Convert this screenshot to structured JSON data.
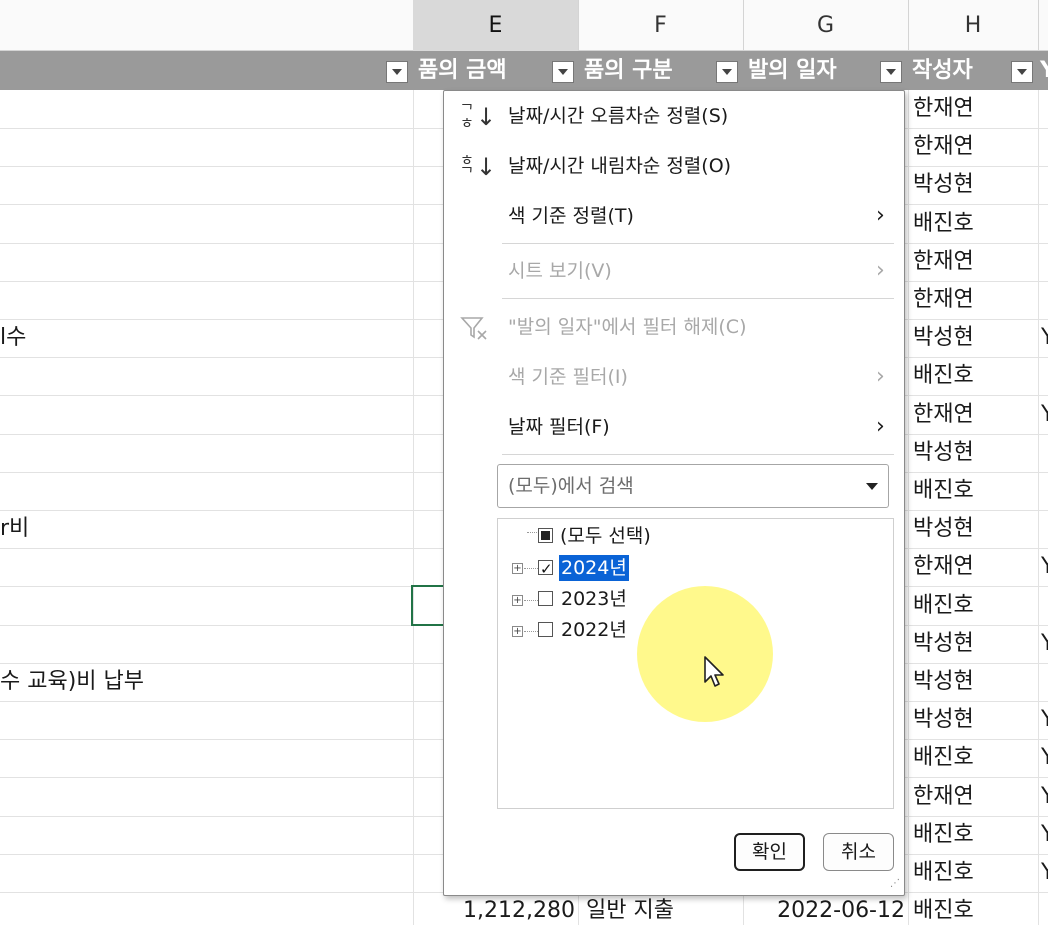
{
  "columns": {
    "E": {
      "label": "E",
      "selected": true
    },
    "F": {
      "label": "F"
    },
    "G": {
      "label": "G"
    },
    "H": {
      "label": "H"
    }
  },
  "table_header": {
    "col_e": "품의 금액",
    "col_f": "품의 구분",
    "col_g": "발의 일자",
    "col_h": "작성자",
    "col_i": "Y"
  },
  "rows": [
    {
      "d": "",
      "h": "한재연",
      "i": ""
    },
    {
      "d": "",
      "h": "한재연",
      "i": ""
    },
    {
      "d": "",
      "h": "박성현",
      "i": ""
    },
    {
      "d": "",
      "h": "배진호",
      "i": ""
    },
    {
      "d": "",
      "h": "한재연",
      "i": ""
    },
    {
      "d": "",
      "h": "한재연",
      "i": ""
    },
    {
      "d": "l수",
      "h": "박성현",
      "i": "Y"
    },
    {
      "d": "",
      "h": "배진호",
      "i": ""
    },
    {
      "d": "",
      "h": "한재연",
      "i": "Y"
    },
    {
      "d": "",
      "h": "박성현",
      "i": ""
    },
    {
      "d": "",
      "h": "배진호",
      "i": ""
    },
    {
      "d": "r비",
      "h": "박성현",
      "i": ""
    },
    {
      "d": "",
      "h": "한재연",
      "i": "Y"
    },
    {
      "d": "",
      "h": "배진호",
      "i": ""
    },
    {
      "d": "",
      "h": "박성현",
      "i": "Y"
    },
    {
      "d": "수 교육)비 납부",
      "h": "박성현",
      "i": ""
    },
    {
      "d": "",
      "h": "박성현",
      "i": "Y"
    },
    {
      "d": "",
      "h": "배진호",
      "i": "Y"
    },
    {
      "d": "",
      "h": "한재연",
      "i": "Y"
    },
    {
      "d": "",
      "h": "배진호",
      "i": "Y"
    },
    {
      "d": "",
      "h": "배진호",
      "i": "Y"
    }
  ],
  "last_row": {
    "amount": "1,212,280",
    "type": "일반 지출",
    "date": "2022-06-12",
    "author": "배진호"
  },
  "menu": {
    "sort_asc": "날짜/시간 오름차순 정렬(S)",
    "sort_desc": "날짜/시간 내림차순 정렬(O)",
    "sort_color": "색 기준 정렬(T)",
    "sheet_view": "시트 보기(V)",
    "clear_filter": "\"발의 일자\"에서 필터 해제(C)",
    "filter_color": "색 기준 필터(I)",
    "date_filter": "날짜 필터(F)",
    "sort_asc_icon_top": "ᄀ",
    "sort_asc_icon_bottom": "ㅎ",
    "sort_desc_icon_top": "ㅎ",
    "sort_desc_icon_bottom": "ᄀ"
  },
  "search": {
    "placeholder": "(모두)에서 검색"
  },
  "tree": {
    "select_all": "(모두 선택)",
    "items": [
      {
        "label": "2024년",
        "checked": true
      },
      {
        "label": "2023년",
        "checked": false
      },
      {
        "label": "2022년",
        "checked": false
      }
    ]
  },
  "buttons": {
    "ok": "확인",
    "cancel": "취소"
  },
  "colors": {
    "accent": "#217346",
    "header_bar": "#9a9a9a",
    "selection": "#0a63d6",
    "highlight": "#fff878"
  }
}
